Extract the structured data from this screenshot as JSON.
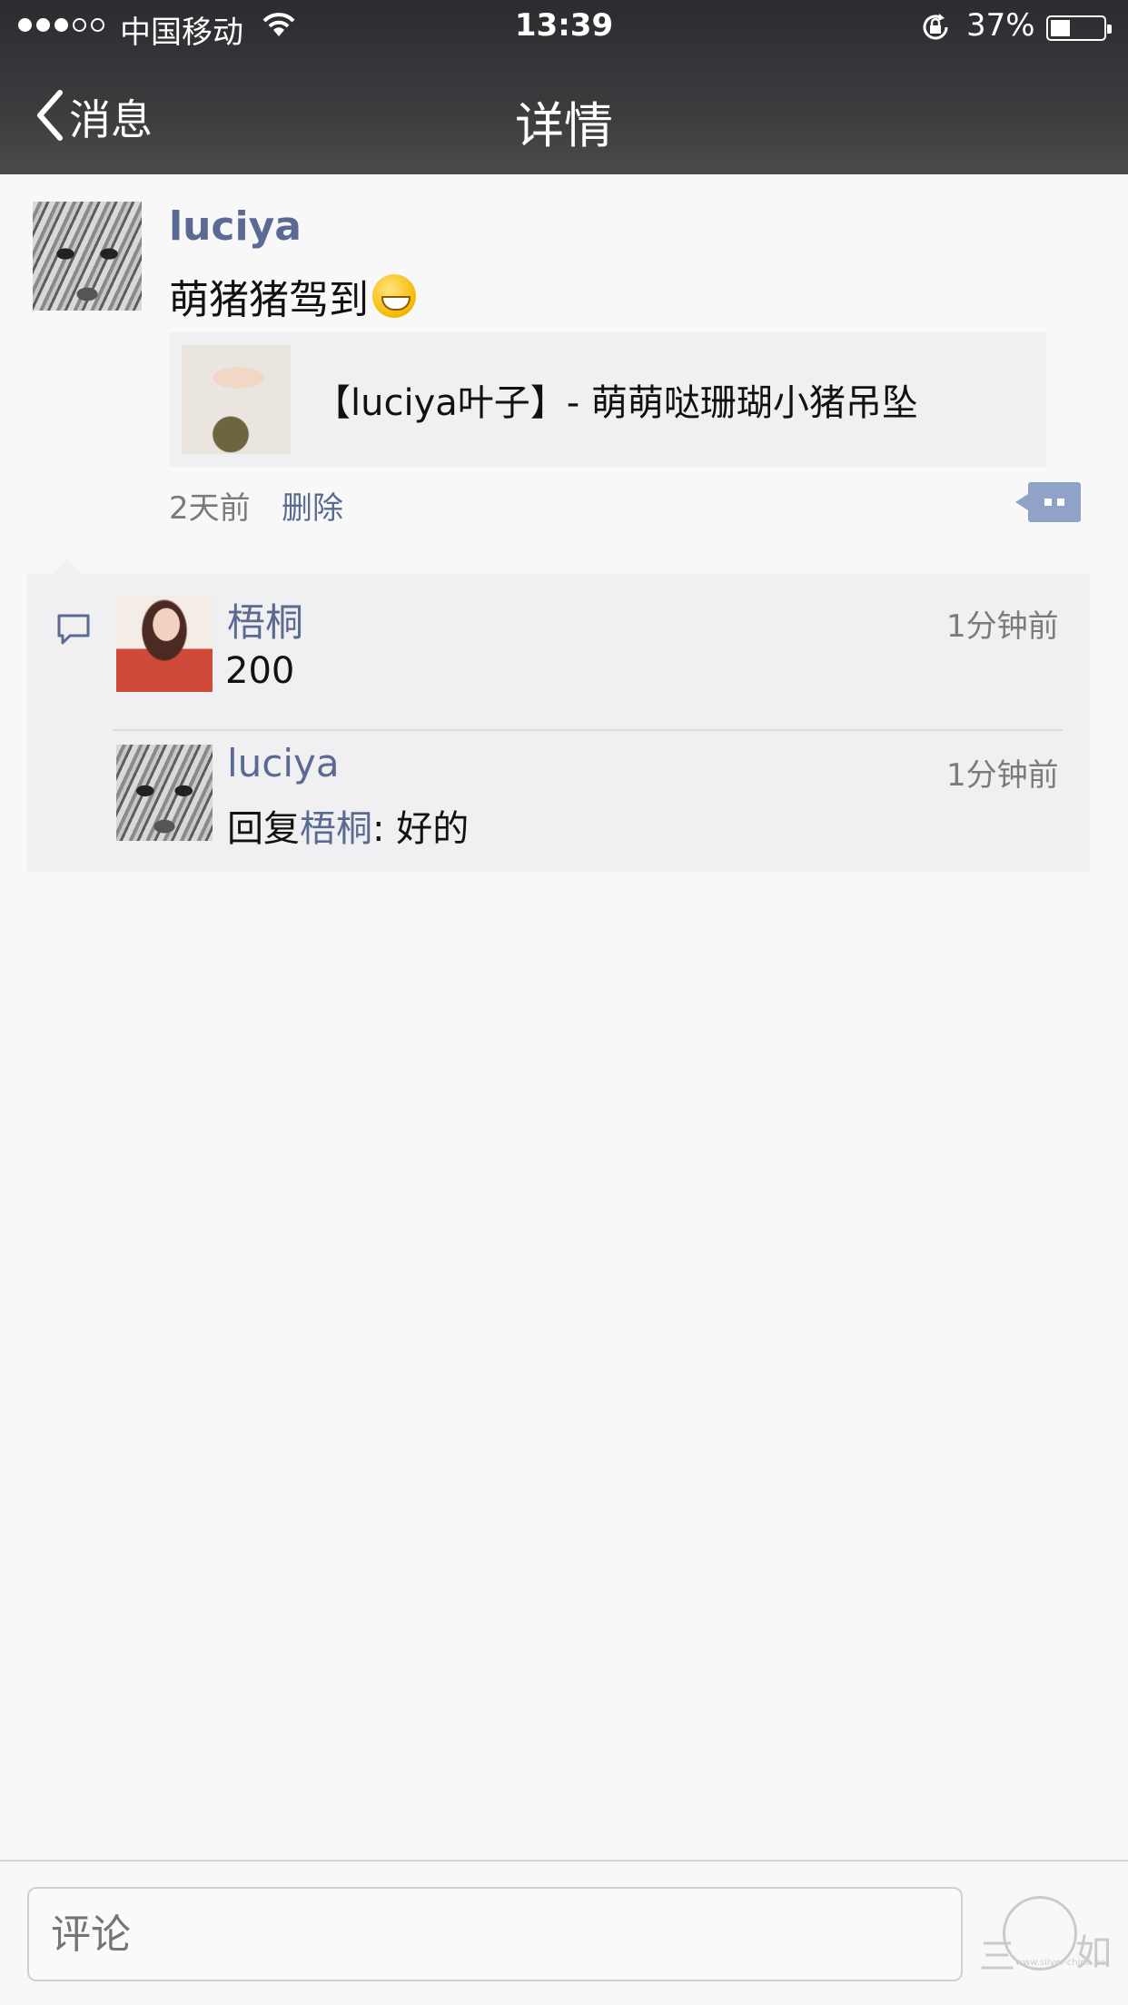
{
  "status_bar": {
    "carrier": "中国移动",
    "time": "13:39",
    "battery_percent": "37%",
    "battery_level": 0.37,
    "signal_bars_filled": 3,
    "signal_bars_total": 5
  },
  "nav": {
    "back_label": "消息",
    "title": "详情"
  },
  "post": {
    "author": "luciya",
    "text": "萌猪猪驾到",
    "link_title": "【luciya叶子】- 萌萌哒珊瑚小猪吊坠",
    "time": "2天前",
    "delete_label": "删除"
  },
  "comments": [
    {
      "author": "梧桐",
      "time": "1分钟前",
      "text": "200"
    },
    {
      "author": "luciya",
      "time": "1分钟前",
      "reply_prefix": "回复",
      "reply_to": "梧桐",
      "reply_sep": ": ",
      "text": "好的"
    }
  ],
  "input": {
    "placeholder": "评论"
  },
  "watermark": {
    "left_char": "三",
    "right_char": "如",
    "url": "www.silver-china.net"
  },
  "colors": {
    "link_blue": "#5b6a92",
    "nav_bg": "#333336",
    "comment_bg": "#f0f0f2",
    "more_button": "#8fa3c8"
  }
}
